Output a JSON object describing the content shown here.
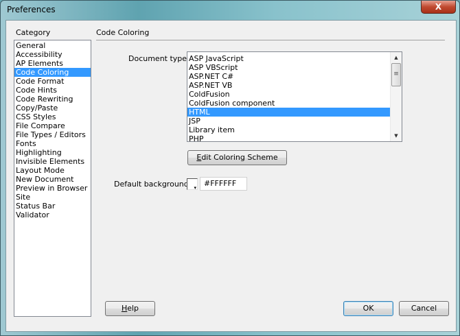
{
  "window": {
    "title": "Preferences",
    "close_label": "X"
  },
  "category": {
    "label": "Category",
    "items": [
      "General",
      "Accessibility",
      "AP Elements",
      "Code Coloring",
      "Code Format",
      "Code Hints",
      "Code Rewriting",
      "Copy/Paste",
      "CSS Styles",
      "File Compare",
      "File Types / Editors",
      "Fonts",
      "Highlighting",
      "Invisible Elements",
      "Layout Mode",
      "New Document",
      "Preview in Browser",
      "Site",
      "Status Bar",
      "Validator"
    ],
    "selected": "Code Coloring"
  },
  "panel": {
    "title": "Code Coloring",
    "doc_type_label": "Document type:",
    "doc_types": [
      "ASP JavaScript",
      "ASP VBScript",
      "ASP.NET C#",
      "ASP.NET VB",
      "ColdFusion",
      "ColdFusion component",
      "HTML",
      "JSP",
      "Library item",
      "PHP"
    ],
    "selected_doc_type": "HTML",
    "edit_button": {
      "accel": "E",
      "rest": "dit Coloring Scheme"
    },
    "default_bg_label": "Default background:",
    "default_bg_value": "#FFFFFF"
  },
  "buttons": {
    "help": {
      "accel": "H",
      "rest": "elp"
    },
    "ok": "OK",
    "cancel": "Cancel"
  }
}
